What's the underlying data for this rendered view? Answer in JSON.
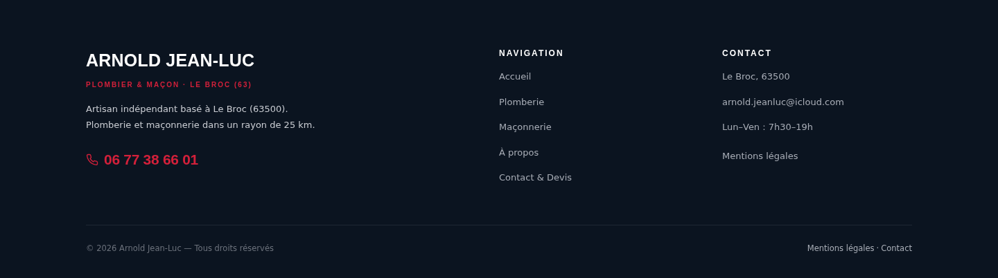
{
  "brand": {
    "name": "ARNOLD JEAN-LUC",
    "tagline": "PLOMBIER & MAÇON · LE BROC (63)",
    "description": [
      "Artisan indépendant basé à Le Broc (63500).",
      "Plomberie et maçonnerie dans un rayon de 25 km."
    ],
    "phone": "06 77 38 66 01"
  },
  "navigation": {
    "heading": "NAVIGATION",
    "links": [
      "Accueil",
      "Plomberie",
      "Maçonnerie",
      "À propos",
      "Contact & Devis"
    ]
  },
  "contact": {
    "heading": "CONTACT",
    "lines": [
      "Le Broc, 63500",
      "arnold.jeanluc@icloud.com",
      "Lun–Ven : 7h30–19h"
    ],
    "legal_link": "Mentions légales"
  },
  "bottom_bar": {
    "copyright": "© 2026 Arnold Jean-Luc — Tous droits réservés",
    "links": [
      "Mentions légales",
      "Contact"
    ],
    "separator": "·"
  }
}
